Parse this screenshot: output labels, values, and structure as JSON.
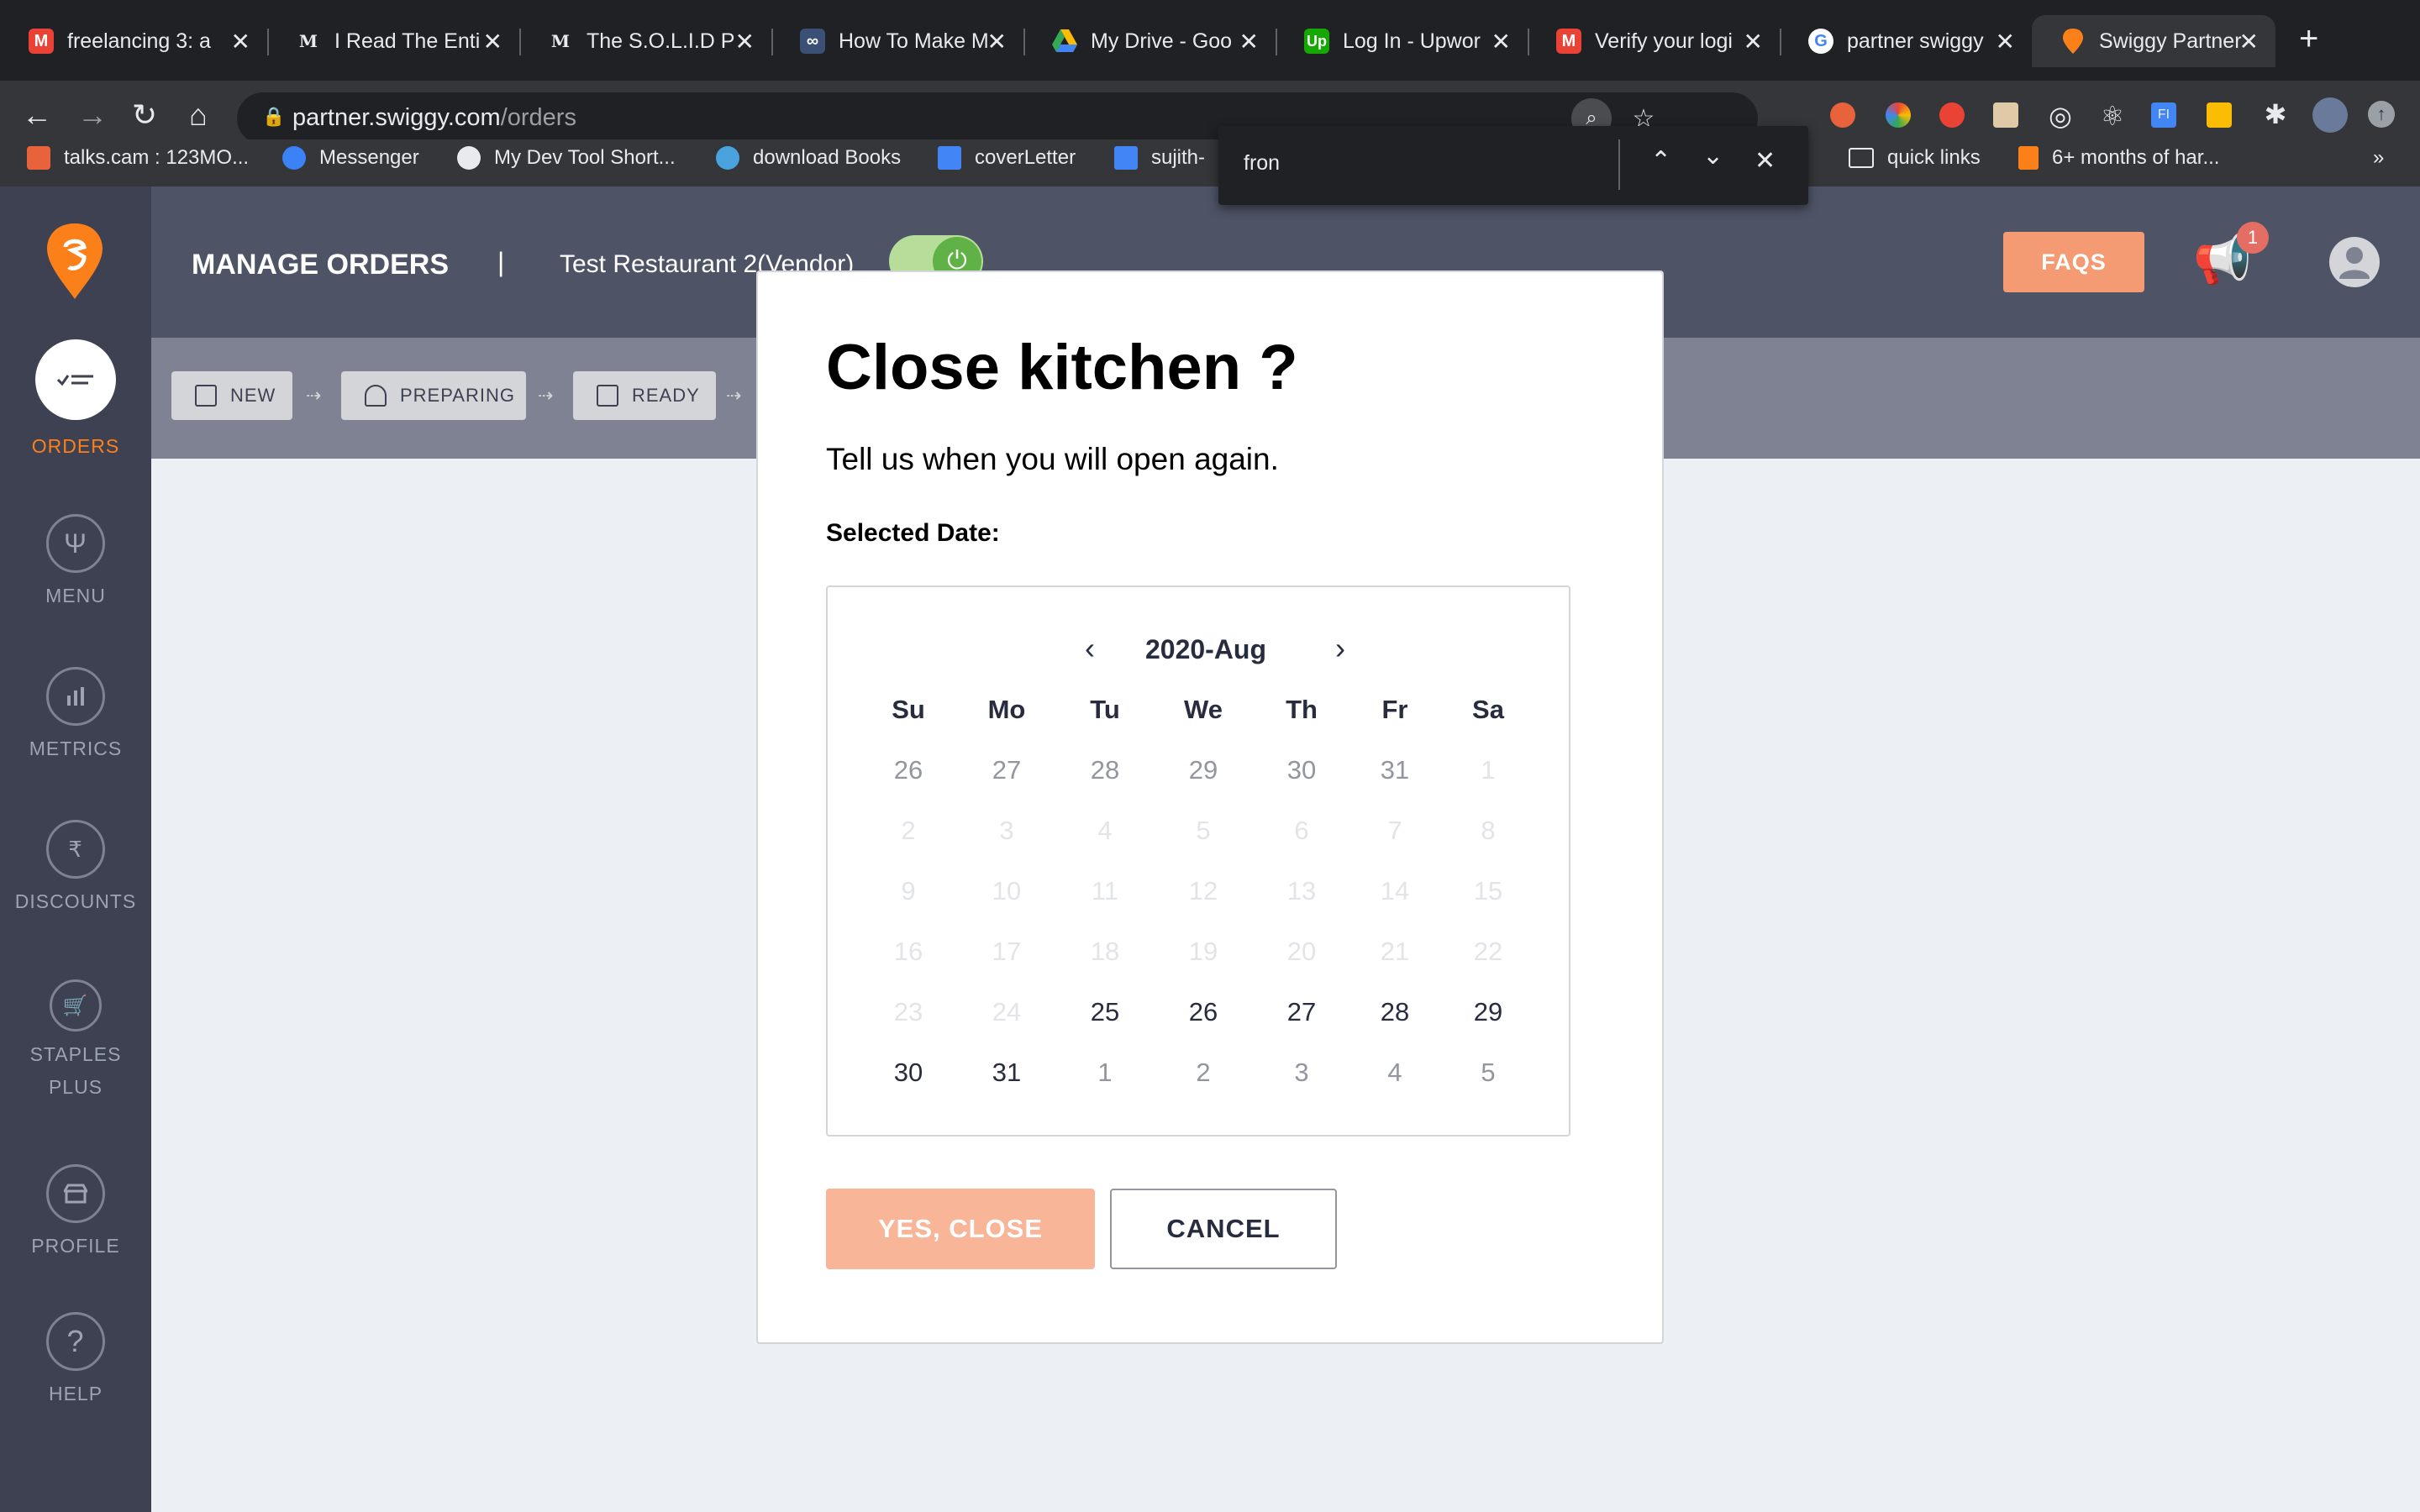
{
  "browser": {
    "tabs": [
      {
        "title": "freelancing 3: a",
        "icon": "gmail-404-icon",
        "color": "#ea4335"
      },
      {
        "title": "I Read The Enti",
        "icon": "medium-icon",
        "color": "#333333"
      },
      {
        "title": "The S.O.L.I.D P",
        "icon": "medium-icon",
        "color": "#333333"
      },
      {
        "title": "How To Make M",
        "icon": "infinity-icon",
        "color": "#3c4f74"
      },
      {
        "title": "My Drive - Goo",
        "icon": "google-drive-icon",
        "color": "#34a853"
      },
      {
        "title": "Log In - Upwor",
        "icon": "upwork-icon",
        "color": "#14a800"
      },
      {
        "title": "Verify your logi",
        "icon": "gmail-icon",
        "color": "#ea4335"
      },
      {
        "title": "partner swiggy",
        "icon": "google-icon",
        "color": "#4285f4"
      },
      {
        "title": "Swiggy Partner",
        "icon": "swiggy-icon",
        "color": "#fc8019"
      }
    ],
    "url_host": "partner.swiggy.com",
    "url_path": "/orders",
    "bookmarks": [
      {
        "label": "talks.cam : 123MO...",
        "color": "#e8623c"
      },
      {
        "label": "Messenger",
        "color": "#3b82f6"
      },
      {
        "label": "My Dev Tool Short...",
        "color": "#e8eaed"
      },
      {
        "label": "download Books",
        "color": "#4aa3df"
      },
      {
        "label": "coverLetter",
        "color": "#4285f4"
      },
      {
        "label": "sujith-",
        "color": "#4285f4"
      },
      {
        "label": "quick links",
        "color": "#e8eaed"
      },
      {
        "label": "6+ months of har...",
        "color": "#fc8019"
      }
    ],
    "more_bookmarks": "»",
    "find": {
      "query": "fron"
    }
  },
  "app": {
    "header_title": "MANAGE ORDERS",
    "divider": "|",
    "restaurant": "Test Restaurant 2(Vendor)",
    "faq_label": "FAQS",
    "notification_count": "1",
    "stages": [
      "NEW",
      "PREPARING",
      "READY"
    ],
    "sidebar": [
      {
        "label": "ORDERS",
        "icon": "orders-icon"
      },
      {
        "label": "MENU",
        "icon": "fork-knife-icon"
      },
      {
        "label": "METRICS",
        "icon": "bar-chart-icon"
      },
      {
        "label": "DISCOUNTS",
        "icon": "rupee-icon"
      },
      {
        "label": "STAPLES",
        "label2": "PLUS",
        "icon": "cart-icon"
      },
      {
        "label": "PROFILE",
        "icon": "store-icon"
      },
      {
        "label": "HELP",
        "icon": "question-icon"
      }
    ],
    "accent": "#fc8019"
  },
  "modal": {
    "title": "Close kitchen ?",
    "subtitle": "Tell us when you will open again.",
    "selected_label": "Selected Date:",
    "calendar": {
      "month": "2020-Aug",
      "prev": "‹",
      "next": "›",
      "weekdays": [
        "Su",
        "Mo",
        "Tu",
        "We",
        "Th",
        "Fr",
        "Sa"
      ],
      "weeks": [
        [
          "26",
          "27",
          "28",
          "29",
          "30",
          "31",
          "1"
        ],
        [
          "2",
          "3",
          "4",
          "5",
          "6",
          "7",
          "8"
        ],
        [
          "9",
          "10",
          "11",
          "12",
          "13",
          "14",
          "15"
        ],
        [
          "16",
          "17",
          "18",
          "19",
          "20",
          "21",
          "22"
        ],
        [
          "23",
          "24",
          "25",
          "26",
          "27",
          "28",
          "29"
        ],
        [
          "30",
          "31",
          "1",
          "2",
          "3",
          "4",
          "5"
        ]
      ]
    },
    "yes_label": "YES, CLOSE",
    "cancel_label": "CANCEL"
  }
}
